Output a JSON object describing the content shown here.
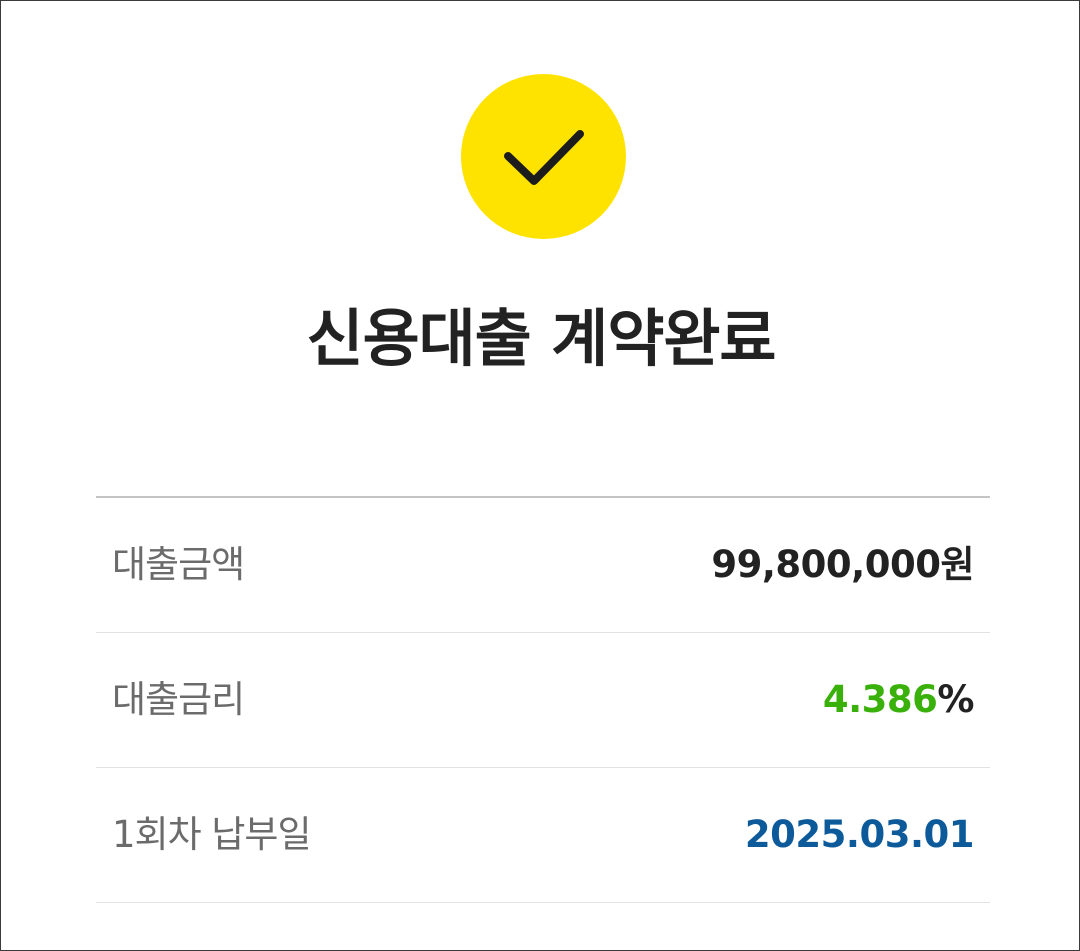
{
  "header": {
    "icon": "check-icon",
    "icon_color": "#ffe300",
    "title": "신용대출 계약완료"
  },
  "details": [
    {
      "label": "대출금액",
      "value": "99,800,000원",
      "value_color": "#222222"
    },
    {
      "label": "대출금리",
      "value_number": "4.386",
      "value_unit": "%",
      "value_color": "#3ab10a"
    },
    {
      "label": "1회차 납부일",
      "value": "2025.03.01",
      "value_color": "#0d5a9a"
    }
  ]
}
